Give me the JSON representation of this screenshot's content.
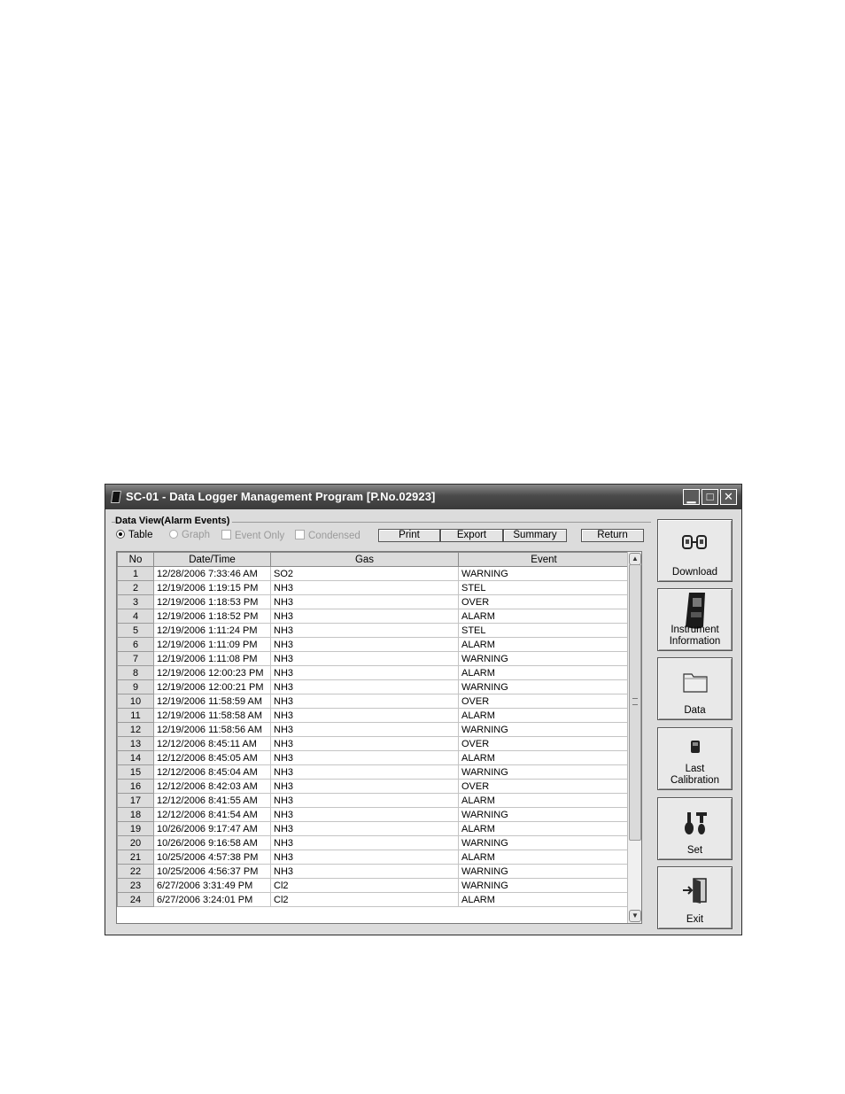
{
  "window": {
    "title": "SC-01 - Data Logger Management Program [P.No.02923]",
    "controls": {
      "minimize": "▁",
      "maximize": "□",
      "close": "✕"
    }
  },
  "data_view": {
    "group_label": "Data View(Alarm Events)",
    "options": {
      "table": "Table",
      "graph": "Graph",
      "event_only": "Event Only",
      "condensed": "Condensed"
    },
    "buttons": {
      "print": "Print",
      "export": "Export",
      "summary": "Summary",
      "return": "Return"
    }
  },
  "table": {
    "headers": [
      "No",
      "Date/Time",
      "Gas",
      "Event"
    ],
    "rows": [
      [
        "1",
        "12/28/2006 7:33:46 AM",
        "SO2",
        "WARNING"
      ],
      [
        "2",
        "12/19/2006 1:19:15 PM",
        "NH3",
        "STEL"
      ],
      [
        "3",
        "12/19/2006 1:18:53 PM",
        "NH3",
        "OVER"
      ],
      [
        "4",
        "12/19/2006 1:18:52 PM",
        "NH3",
        "ALARM"
      ],
      [
        "5",
        "12/19/2006 1:11:24 PM",
        "NH3",
        "STEL"
      ],
      [
        "6",
        "12/19/2006 1:11:09 PM",
        "NH3",
        "ALARM"
      ],
      [
        "7",
        "12/19/2006 1:11:08 PM",
        "NH3",
        "WARNING"
      ],
      [
        "8",
        "12/19/2006 12:00:23 PM",
        "NH3",
        "ALARM"
      ],
      [
        "9",
        "12/19/2006 12:00:21 PM",
        "NH3",
        "WARNING"
      ],
      [
        "10",
        "12/19/2006 11:58:59 AM",
        "NH3",
        "OVER"
      ],
      [
        "11",
        "12/19/2006 11:58:58 AM",
        "NH3",
        "ALARM"
      ],
      [
        "12",
        "12/19/2006 11:58:56 AM",
        "NH3",
        "WARNING"
      ],
      [
        "13",
        "12/12/2006 8:45:11 AM",
        "NH3",
        "OVER"
      ],
      [
        "14",
        "12/12/2006 8:45:05 AM",
        "NH3",
        "ALARM"
      ],
      [
        "15",
        "12/12/2006 8:45:04 AM",
        "NH3",
        "WARNING"
      ],
      [
        "16",
        "12/12/2006 8:42:03 AM",
        "NH3",
        "OVER"
      ],
      [
        "17",
        "12/12/2006 8:41:55 AM",
        "NH3",
        "ALARM"
      ],
      [
        "18",
        "12/12/2006 8:41:54 AM",
        "NH3",
        "WARNING"
      ],
      [
        "19",
        "10/26/2006 9:17:47 AM",
        "NH3",
        "ALARM"
      ],
      [
        "20",
        "10/26/2006 9:16:58 AM",
        "NH3",
        "WARNING"
      ],
      [
        "21",
        "10/25/2006 4:57:38 PM",
        "NH3",
        "ALARM"
      ],
      [
        "22",
        "10/25/2006 4:56:37 PM",
        "NH3",
        "WARNING"
      ],
      [
        "23",
        "6/27/2006 3:31:49 PM",
        "Cl2",
        "WARNING"
      ],
      [
        "24",
        "6/27/2006 3:24:01 PM",
        "Cl2",
        "ALARM"
      ]
    ]
  },
  "sidebar": {
    "download": "Download",
    "instrument_1": "Instrument",
    "instrument_2": "Information",
    "data": "Data",
    "last_cal_1": "Last",
    "last_cal_2": "Calibration",
    "set": "Set",
    "exit": "Exit"
  },
  "icons": {
    "download": "download-icon",
    "instrument": "instrument-icon",
    "data": "folder-icon",
    "calibration": "calibration-icon",
    "set": "tools-icon",
    "exit": "exit-door-icon"
  }
}
